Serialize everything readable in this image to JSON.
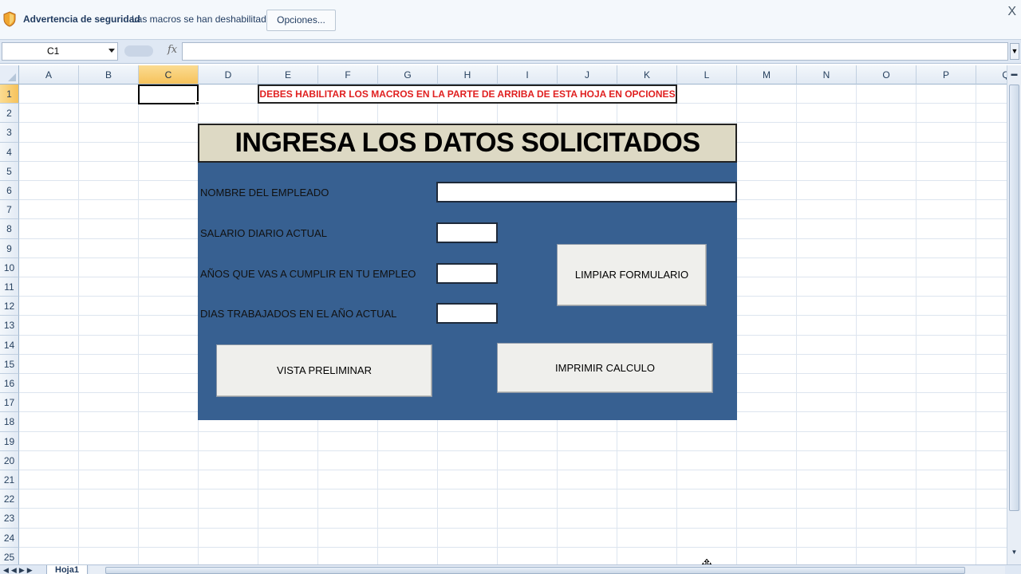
{
  "security_bar": {
    "title": "Advertencia de seguridad",
    "message": "Las macros se han deshabilitado.",
    "options_label": "Opciones...",
    "close_label": "X"
  },
  "formula_bar": {
    "name_box": "C1",
    "fx_label": "fx",
    "formula": ""
  },
  "columns": [
    "A",
    "B",
    "C",
    "D",
    "E",
    "F",
    "G",
    "H",
    "I",
    "J",
    "K",
    "L",
    "M",
    "N",
    "O",
    "P",
    "Q"
  ],
  "rows": [
    "1",
    "2",
    "3",
    "4",
    "5",
    "6",
    "7",
    "8",
    "9",
    "10",
    "11",
    "12",
    "13",
    "14",
    "15",
    "16",
    "17",
    "18",
    "19",
    "20",
    "21",
    "22",
    "23",
    "24",
    "25"
  ],
  "active_cell": {
    "column": "C",
    "row": "1"
  },
  "sheet": {
    "warning_text": "DEBES HABILITAR LOS MACROS EN LA PARTE DE ARRIBA DE ESTA HOJA EN OPCIONES",
    "form_title": "INGRESA LOS DATOS SOLICITADOS",
    "fields": {
      "employee_name_label": "NOMBRE DEL EMPLEADO",
      "daily_salary_label": "SALARIO DIARIO ACTUAL",
      "years_label": "AÑOS QUE VAS A CUMPLIR EN TU EMPLEO",
      "days_worked_label": "DIAS TRABAJADOS EN EL AÑO ACTUAL"
    },
    "buttons": {
      "clear_form": "LIMPIAR FORMULARIO",
      "preview": "VISTA PRELIMINAR",
      "print_calc": "IMPRIMIR CALCULO"
    }
  },
  "tabs": {
    "sheet1": "Hoja1"
  },
  "colors": {
    "form_panel": "#376091",
    "form_title_bg": "#ddd9c4",
    "warning_text": "#e02020",
    "active_header": "#f6c25b"
  }
}
